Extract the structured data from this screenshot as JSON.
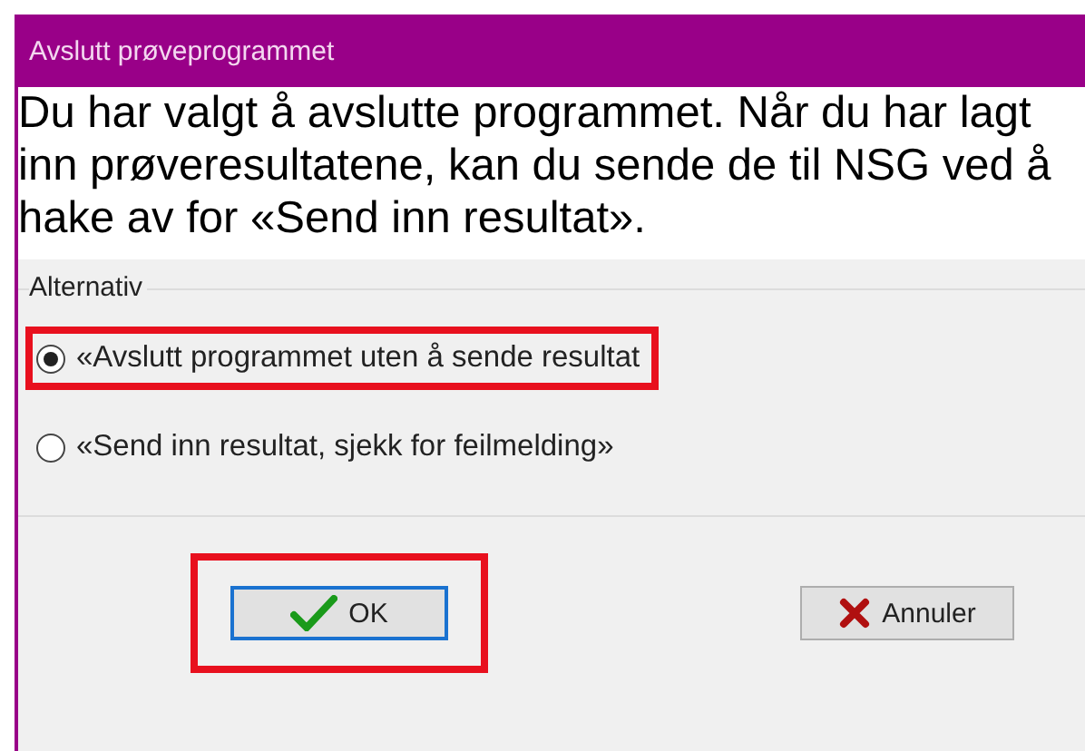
{
  "window": {
    "title": "Avslutt prøveprogrammet"
  },
  "message": "Du har valgt å avslutte programmet. Når du har lagt inn prøveresultatene, kan du sende de til NSG ved å hake av for «Send inn resultat».",
  "group": {
    "label": "Alternativ",
    "options": [
      {
        "label": "«Avslutt programmet uten å sende resultat",
        "selected": true,
        "highlighted": true
      },
      {
        "label": "«Send inn resultat, sjekk for feilmelding»",
        "selected": false,
        "highlighted": false
      }
    ]
  },
  "buttons": [
    {
      "kind": "ok",
      "label": "OK",
      "highlighted": true,
      "focused": true
    },
    {
      "kind": "cancel",
      "label": "Annuler",
      "highlighted": false,
      "focused": false
    }
  ]
}
